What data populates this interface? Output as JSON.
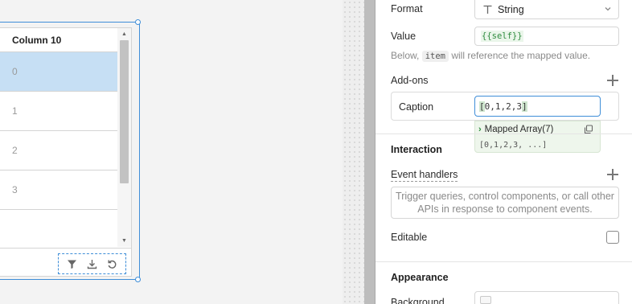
{
  "table": {
    "column_header": "Column 10",
    "rows": [
      "0",
      "1",
      "2",
      "3"
    ],
    "selected_row_index": 0,
    "footer_tools": [
      "filter-icon",
      "download-icon",
      "refresh-icon"
    ]
  },
  "inspector": {
    "format_label": "Format",
    "format_value": "String",
    "value_label": "Value",
    "value_code": "{{self}}",
    "hint_before": "Below,",
    "hint_code": "item",
    "hint_after": "will reference the mapped value.",
    "addons_label": "Add-ons",
    "caption_label": "Caption",
    "caption_value_open": "[",
    "caption_value_inner": "0,1,2,3",
    "caption_value_close": "]",
    "preview_title": "Mapped Array(7)",
    "preview_value": "[0,1,2,3, ...]",
    "interaction_heading": "Interaction",
    "event_handlers_label": "Event handlers",
    "event_handlers_empty": "Trigger queries, control components, or call other APIs in response to component events.",
    "editable_label": "Editable",
    "editable_checked": false,
    "appearance_heading": "Appearance",
    "background_label": "Background"
  },
  "colors": {
    "selection_blue": "#3f8ed8",
    "selected_row": "#c6dff4",
    "code_green": "#2e8b3e"
  }
}
